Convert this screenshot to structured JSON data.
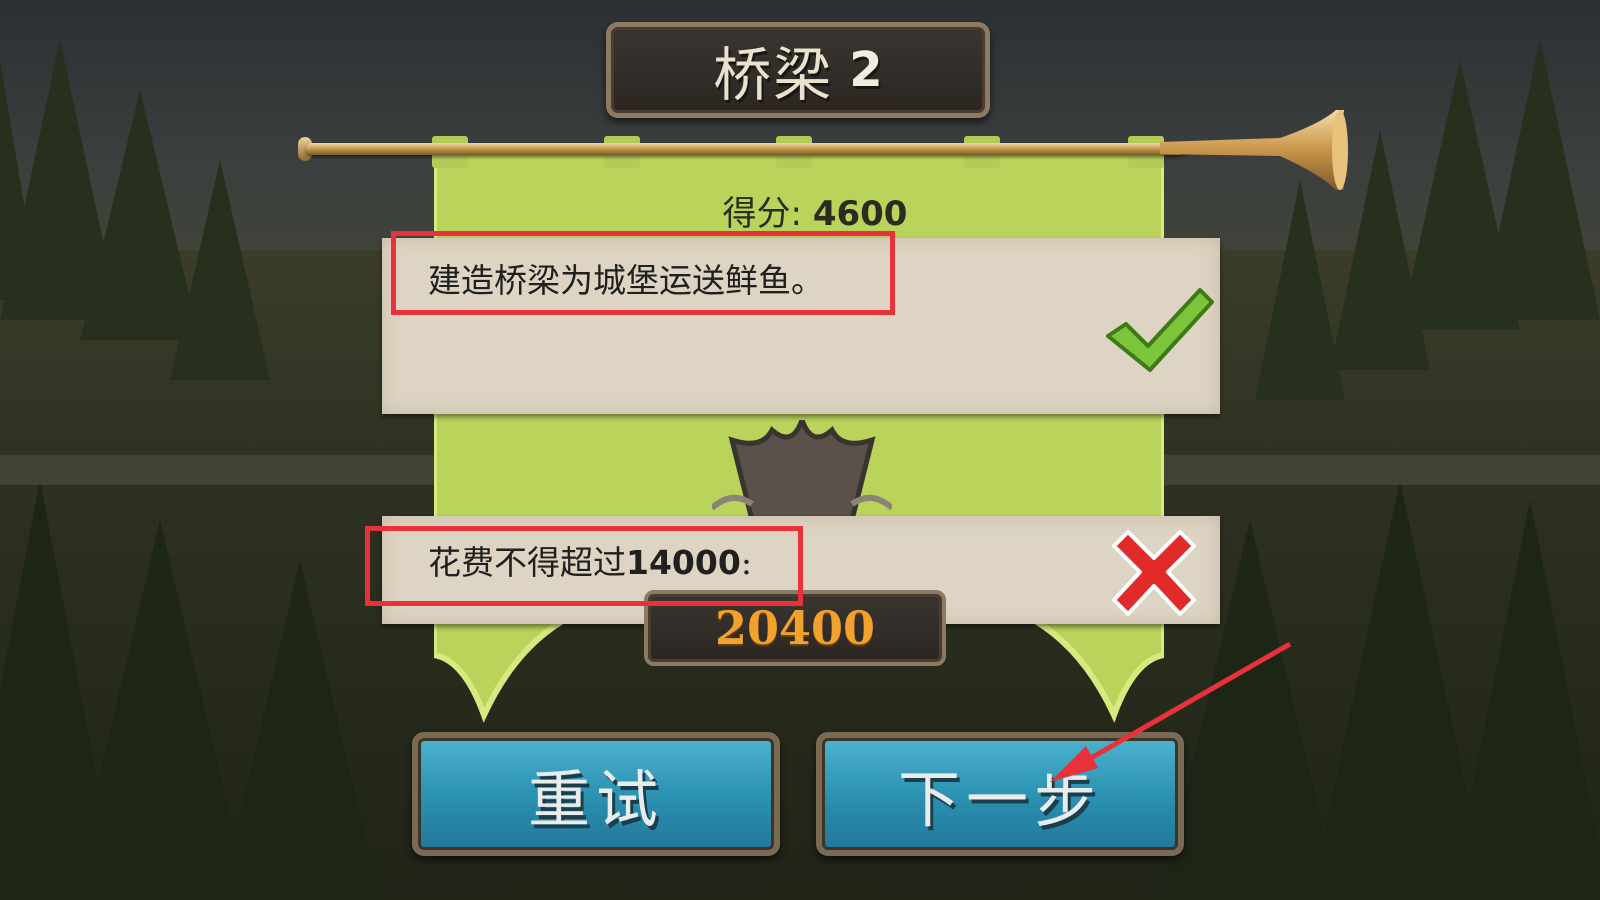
{
  "title": {
    "text": "桥梁",
    "level": "2"
  },
  "score": {
    "label": "得分:",
    "value": "4600"
  },
  "objectives": [
    {
      "text": "建造桥梁为城堡运送鲜鱼。",
      "status": "completed",
      "icon": "check-icon"
    },
    {
      "text_prefix": "花费不得超过",
      "limit": "14000",
      "suffix": ":",
      "status": "failed",
      "icon": "cross-icon"
    }
  ],
  "cost": {
    "value": "20400"
  },
  "buttons": {
    "retry": "重试",
    "next": "下一步"
  },
  "colors": {
    "banner": "#b9d35b",
    "paper": "#ddd4c3",
    "button": "#2a8fb0",
    "highlight": "#e8313a",
    "check": "#7cc53a",
    "cross": "#e12a2a",
    "cost_text": "#f0a22c"
  }
}
